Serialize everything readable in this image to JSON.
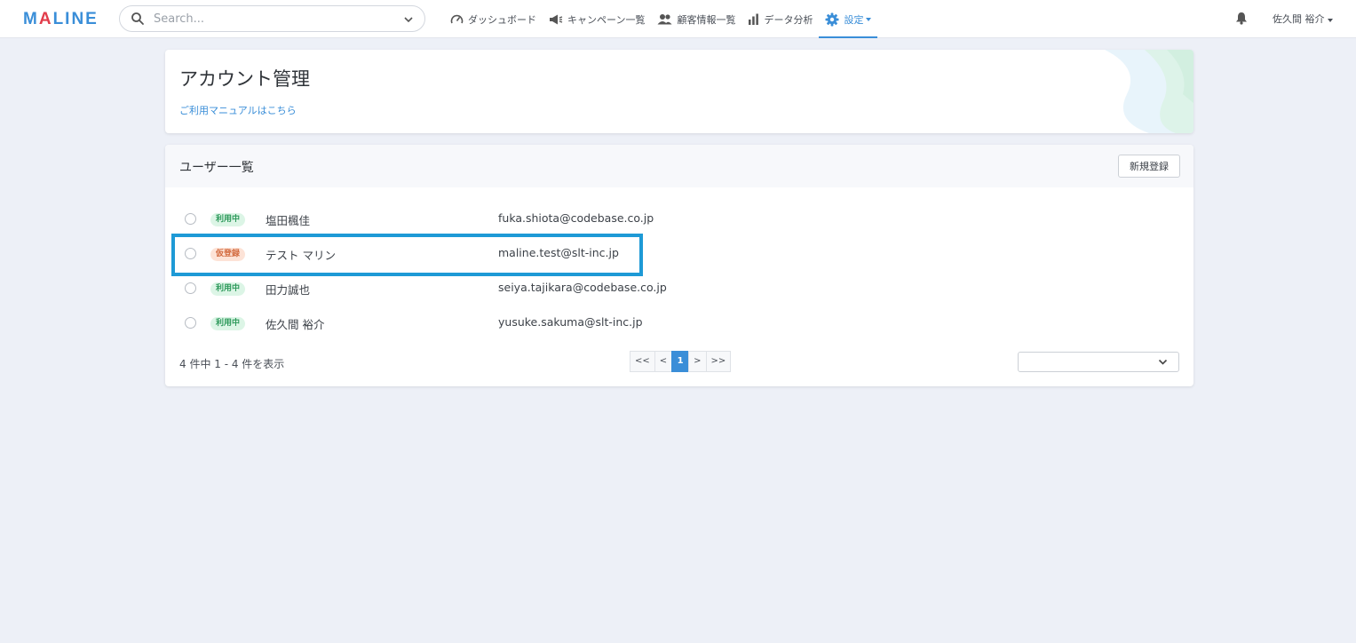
{
  "brand": {
    "logo": "MALINE"
  },
  "search": {
    "placeholder": "Search..."
  },
  "nav": [
    {
      "label": "ダッシュボード",
      "icon": "gauge-icon"
    },
    {
      "label": "キャンペーン一覧",
      "icon": "megaphone-icon"
    },
    {
      "label": "顧客情報一覧",
      "icon": "users-icon"
    },
    {
      "label": "データ分析",
      "icon": "bar-chart-icon"
    },
    {
      "label": "設定",
      "icon": "gear-icon",
      "active": true
    }
  ],
  "user_menu": {
    "name": "佐久間 裕介"
  },
  "header_card": {
    "title": "アカウント管理",
    "manual_link": "ご利用マニュアルはこちら"
  },
  "users_card": {
    "title": "ユーザー一覧",
    "new_button": "新規登録",
    "users": [
      {
        "status": "利用中",
        "status_type": "active",
        "name": "塩田楓佳",
        "email": "fuka.shiota@codebase.co.jp"
      },
      {
        "status": "仮登録",
        "status_type": "pending",
        "name": "テスト マリン",
        "email": "maline.test@slt-inc.jp"
      },
      {
        "status": "利用中",
        "status_type": "active",
        "name": "田力誠也",
        "email": "seiya.tajikara@codebase.co.jp"
      },
      {
        "status": "利用中",
        "status_type": "active",
        "name": "佐久間 裕介",
        "email": "yusuke.sakuma@slt-inc.jp"
      }
    ],
    "summary": "4 件中 1 - 4 件を表示",
    "pagination": {
      "first": "<<",
      "prev": "<",
      "current": "1",
      "next": ">",
      "last": ">>"
    }
  },
  "colors": {
    "accent": "#3a8ed8",
    "highlight": "#1e9ad6",
    "active_badge": "#2f9a5c",
    "pending_badge": "#d2683c"
  }
}
